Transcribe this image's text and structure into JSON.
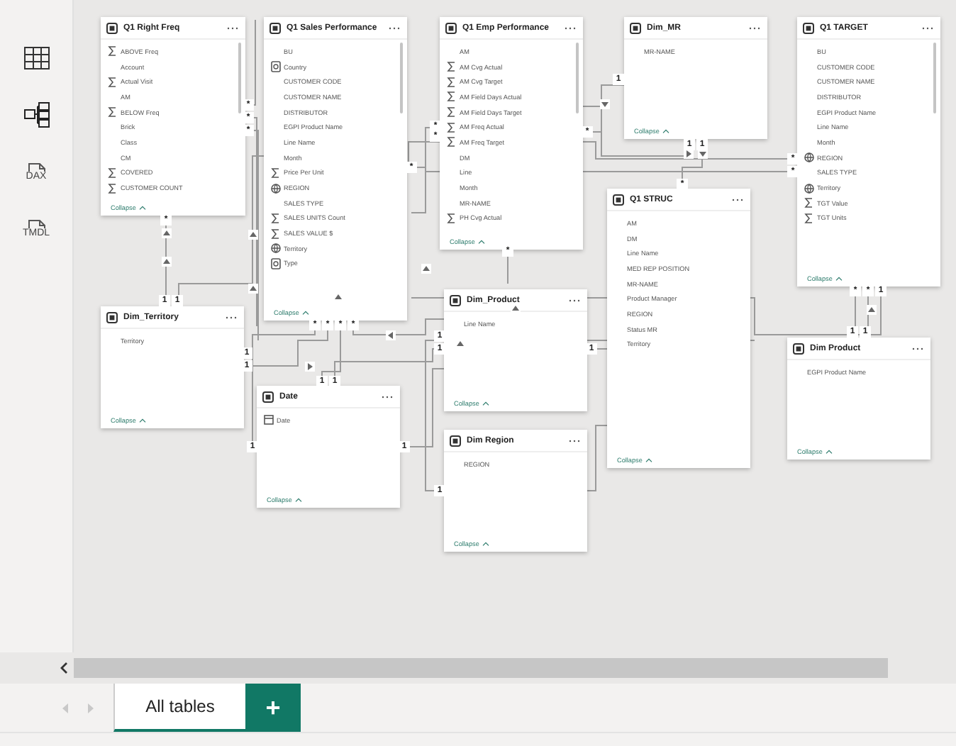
{
  "sidebar": {
    "items": [
      {
        "kind": "table"
      },
      {
        "kind": "model"
      },
      {
        "kind": "file",
        "label": "DAX"
      },
      {
        "kind": "file",
        "label": "TMDL"
      }
    ]
  },
  "tables": [
    {
      "title": "Q1 Right Freq",
      "collapse": "Collapse",
      "fields": [
        {
          "name": "ABOVE Freq",
          "kind": "sum"
        },
        {
          "name": "Account"
        },
        {
          "name": "Actual Visit",
          "kind": "sum"
        },
        {
          "name": "AM"
        },
        {
          "name": "BELOW Freq",
          "kind": "sum"
        },
        {
          "name": "Brick"
        },
        {
          "name": "Class"
        },
        {
          "name": "CM"
        },
        {
          "name": "COVERED",
          "kind": "sum"
        },
        {
          "name": "CUSTOMER COUNT",
          "kind": "sum"
        }
      ]
    },
    {
      "title": "Q1 Sales Performance",
      "collapse": "Collapse",
      "fields": [
        {
          "name": "BU"
        },
        {
          "name": "Country",
          "kind": "category"
        },
        {
          "name": "CUSTOMER CODE"
        },
        {
          "name": "CUSTOMER NAME"
        },
        {
          "name": "DISTRIBUTOR"
        },
        {
          "name": "EGPI Product Name"
        },
        {
          "name": "Line Name"
        },
        {
          "name": "Month"
        },
        {
          "name": "Price Per Unit",
          "kind": "sum"
        },
        {
          "name": "REGION",
          "kind": "globe"
        },
        {
          "name": "SALES TYPE"
        },
        {
          "name": "SALES UNITS Count",
          "kind": "sum"
        },
        {
          "name": "SALES VALUE $",
          "kind": "sum"
        },
        {
          "name": "Territory",
          "kind": "globe"
        },
        {
          "name": "Type",
          "kind": "category"
        }
      ]
    },
    {
      "title": "Q1 Emp Performance",
      "collapse": "Collapse",
      "fields": [
        {
          "name": "AM"
        },
        {
          "name": "AM Cvg Actual",
          "kind": "sum"
        },
        {
          "name": "AM Cvg Target",
          "kind": "sum"
        },
        {
          "name": "AM Field Days Actual",
          "kind": "sum"
        },
        {
          "name": "AM Field Days Target",
          "kind": "sum"
        },
        {
          "name": "AM Freq Actual",
          "kind": "sum"
        },
        {
          "name": "AM Freq Target",
          "kind": "sum"
        },
        {
          "name": "DM"
        },
        {
          "name": "Line"
        },
        {
          "name": "Month"
        },
        {
          "name": "MR-NAME"
        },
        {
          "name": "PH Cvg Actual",
          "kind": "sum"
        }
      ]
    },
    {
      "title": "Dim_MR",
      "collapse": "Collapse",
      "fields": [
        {
          "name": "MR-NAME"
        }
      ]
    },
    {
      "title": "Q1 TARGET",
      "collapse": "Collapse",
      "fields": [
        {
          "name": "BU"
        },
        {
          "name": "CUSTOMER CODE"
        },
        {
          "name": "CUSTOMER NAME"
        },
        {
          "name": "DISTRIBUTOR"
        },
        {
          "name": "EGPI Product Name"
        },
        {
          "name": "Line Name"
        },
        {
          "name": "Month"
        },
        {
          "name": "REGION",
          "kind": "globe"
        },
        {
          "name": "SALES TYPE"
        },
        {
          "name": "Territory",
          "kind": "globe"
        },
        {
          "name": "TGT Value",
          "kind": "sum"
        },
        {
          "name": "TGT Units",
          "kind": "sum"
        }
      ]
    },
    {
      "title": "Q1 STRUC",
      "collapse": "Collapse",
      "fields": [
        {
          "name": "AM"
        },
        {
          "name": "DM"
        },
        {
          "name": "Line Name"
        },
        {
          "name": "MED REP POSITION"
        },
        {
          "name": "MR-NAME"
        },
        {
          "name": "Product Manager"
        },
        {
          "name": "REGION"
        },
        {
          "name": "Status MR"
        },
        {
          "name": "Territory"
        }
      ]
    },
    {
      "title": "Dim_Territory",
      "collapse": "Collapse",
      "fields": [
        {
          "name": "Territory"
        }
      ]
    },
    {
      "title": "Dim_Product",
      "collapse": "Collapse",
      "fields": [
        {
          "name": "Line Name"
        }
      ]
    },
    {
      "title": "Date",
      "collapse": "Collapse",
      "fields": [
        {
          "name": "Date",
          "kind": "calendar"
        }
      ]
    },
    {
      "title": "Dim Region",
      "collapse": "Collapse",
      "fields": [
        {
          "name": "REGION"
        }
      ]
    },
    {
      "title": "Dim Product",
      "collapse": "Collapse",
      "fields": [
        {
          "name": "EGPI Product Name"
        }
      ]
    }
  ],
  "markers": [
    {
      "text": "*"
    },
    {
      "text": "*"
    },
    {
      "text": "*"
    },
    {
      "text": "*"
    },
    {
      "text": "1"
    },
    {
      "text": "1"
    },
    {
      "text": "*"
    },
    {
      "text": "*"
    },
    {
      "text": "*"
    },
    {
      "text": "*"
    },
    {
      "text": "*"
    },
    {
      "text": "1"
    },
    {
      "text": "1"
    },
    {
      "text": "1"
    },
    {
      "text": "1"
    },
    {
      "text": "1"
    },
    {
      "text": "1"
    },
    {
      "text": "*"
    },
    {
      "text": "*"
    },
    {
      "text": "*"
    },
    {
      "text": "*"
    },
    {
      "text": "1"
    },
    {
      "text": "1"
    },
    {
      "text": "1"
    },
    {
      "text": "*"
    },
    {
      "text": "*"
    },
    {
      "text": "*"
    },
    {
      "text": "*"
    },
    {
      "text": "*"
    },
    {
      "text": "1"
    },
    {
      "text": "1"
    },
    {
      "text": "1"
    },
    {
      "text": "1"
    },
    {
      "text": "1"
    },
    {
      "text": "1"
    },
    {
      "text": "1"
    }
  ],
  "tabs": [
    {
      "label": "All tables",
      "selected": true
    }
  ],
  "add_button": "+"
}
